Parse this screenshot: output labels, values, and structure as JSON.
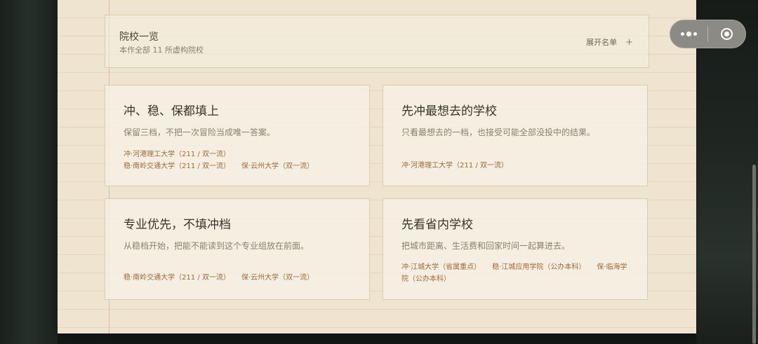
{
  "summary": {
    "title": "院校一览",
    "subtitle": "本作全部 11 所虚构院校",
    "expand_label": "展开名单",
    "expand_icon": "+"
  },
  "cards": [
    {
      "title": "冲、稳、保都填上",
      "description": "保留三档，不把一次冒险当成唯一答案。",
      "schools": [
        "冲·河港理工大学（211 / 双一流）",
        "稳·南岭交通大学（211 / 双一流）",
        "保·云州大学（双一流）"
      ]
    },
    {
      "title": "先冲最想去的学校",
      "description": "只看最想去的一档，也接受可能全部没投中的结果。",
      "schools": [
        "冲·河港理工大学（211 / 双一流）"
      ]
    },
    {
      "title": "专业优先，不填冲档",
      "description": "从稳档开始，把能不能读到这个专业组放在前面。",
      "schools": [
        "稳·南岭交通大学（211 / 双一流）",
        "保·云州大学（双一流）"
      ]
    },
    {
      "title": "先看省内学校",
      "description": "把城市距离、生活费和回家时间一起算进去。",
      "schools": [
        "冲·江城大学（省属重点）",
        "稳·江城应用学院（公办本科）",
        "保·临海学院（公办本科）"
      ]
    }
  ],
  "window_controls": {
    "more_icon": "more-dots-icon",
    "close_icon": "target-close-icon"
  }
}
